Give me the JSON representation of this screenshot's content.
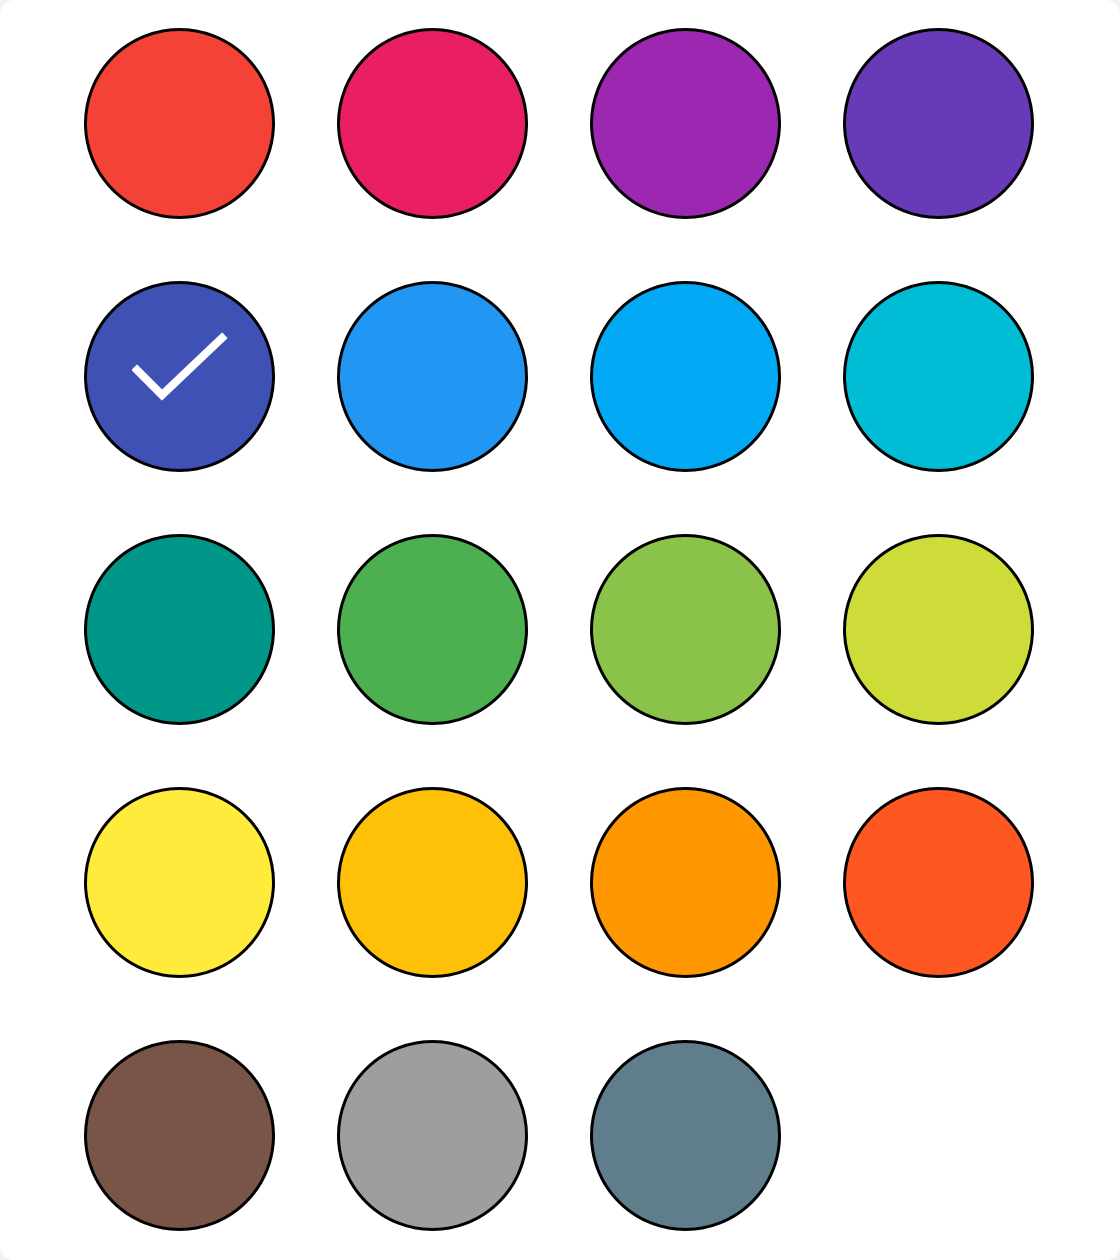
{
  "color_picker": {
    "selected_index": 4,
    "swatches": [
      {
        "name": "red",
        "color": "#F44336"
      },
      {
        "name": "pink",
        "color": "#E91E63"
      },
      {
        "name": "purple",
        "color": "#9C27B0"
      },
      {
        "name": "deep-purple",
        "color": "#673AB7"
      },
      {
        "name": "indigo",
        "color": "#3F51B5"
      },
      {
        "name": "blue",
        "color": "#2196F3"
      },
      {
        "name": "light-blue",
        "color": "#03A9F4"
      },
      {
        "name": "cyan",
        "color": "#00BCD4"
      },
      {
        "name": "teal",
        "color": "#009688"
      },
      {
        "name": "green",
        "color": "#4CAF50"
      },
      {
        "name": "light-green",
        "color": "#8BC34A"
      },
      {
        "name": "lime",
        "color": "#CDDC39"
      },
      {
        "name": "yellow",
        "color": "#FFEB3B"
      },
      {
        "name": "amber",
        "color": "#FFC107"
      },
      {
        "name": "orange",
        "color": "#FF9800"
      },
      {
        "name": "deep-orange",
        "color": "#FF5722"
      },
      {
        "name": "brown",
        "color": "#795548"
      },
      {
        "name": "grey",
        "color": "#9E9E9E"
      },
      {
        "name": "blue-grey",
        "color": "#607D8B"
      }
    ],
    "check_icon": "checkmark-icon",
    "check_color": "#FFFFFF"
  }
}
